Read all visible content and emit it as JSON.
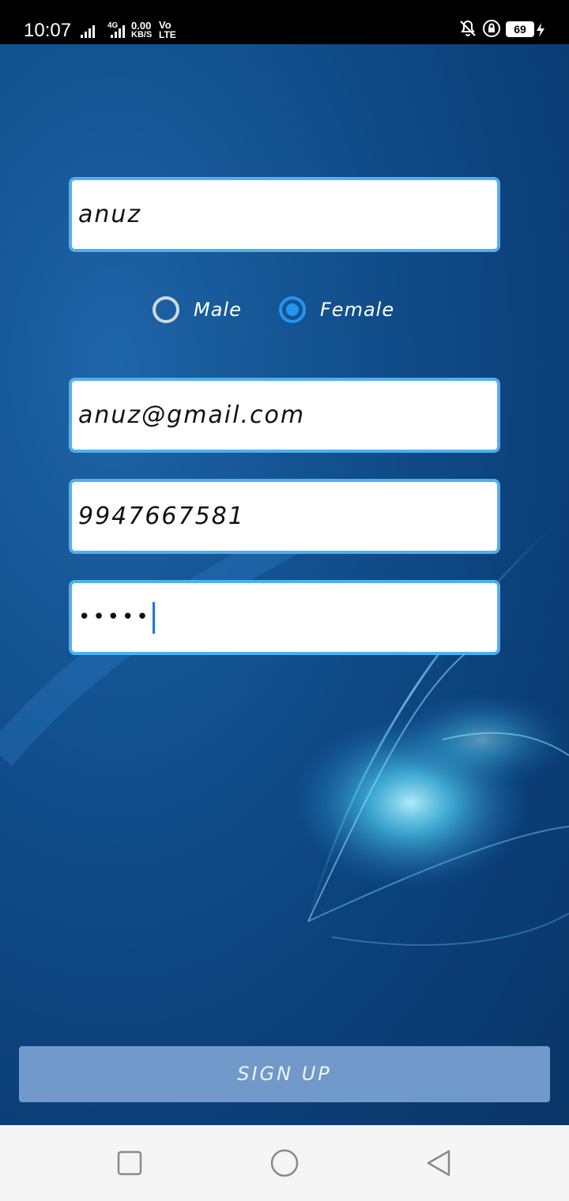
{
  "status_bar": {
    "time": "10:07",
    "network_type": "4G",
    "data_speed_value": "0.00",
    "data_speed_unit": "KB/S",
    "volte_top": "Vo",
    "volte_bottom": "LTE",
    "battery_level": "69"
  },
  "form": {
    "name_value": "anuz",
    "gender": {
      "options": [
        "Male",
        "Female"
      ],
      "selected": "Female"
    },
    "email_value": "anuz@gmail.com",
    "phone_value": "9947667581",
    "password_masked": "•••••"
  },
  "signup_label": "SIGN UP",
  "nav": {
    "recents_icon": "square-icon",
    "home_icon": "circle-icon",
    "back_icon": "triangle-back-icon"
  },
  "colors": {
    "field_border": "#4fb0ee",
    "radio_selected": "#2196f3",
    "button_bg": "#7099c9"
  }
}
